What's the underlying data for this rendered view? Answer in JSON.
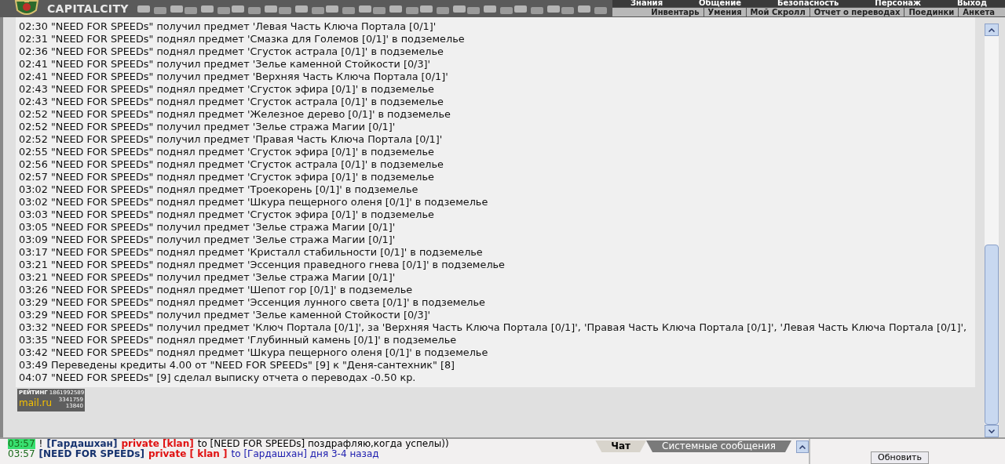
{
  "header": {
    "logo": "CAPITALCITY",
    "menu": [
      {
        "label": "Знания"
      },
      {
        "label": "Общение"
      },
      {
        "label": "Безопасность"
      },
      {
        "label": "Персонаж"
      },
      {
        "label": "Выход"
      }
    ],
    "submenu": [
      {
        "label": "Инвентарь"
      },
      {
        "label": "Умения"
      },
      {
        "label": "Мой Скролл"
      },
      {
        "label": "Отчет о переводах"
      },
      {
        "label": "Поединки"
      },
      {
        "label": "Анкета"
      }
    ]
  },
  "log": [
    {
      "time": "02:30",
      "text": "\"NEED FOR SPEEDs\" получил предмет 'Левая Часть Ключа Портала [0/1]'"
    },
    {
      "time": "02:31",
      "text": "\"NEED FOR SPEEDs\" поднял предмет 'Смазка для Големов [0/1]' в подземелье"
    },
    {
      "time": "02:36",
      "text": "\"NEED FOR SPEEDs\" поднял предмет 'Сгусток астрала [0/1]' в подземелье"
    },
    {
      "time": "02:41",
      "text": "\"NEED FOR SPEEDs\" получил предмет 'Зелье каменной Стойкости [0/3]'"
    },
    {
      "time": "02:41",
      "text": "\"NEED FOR SPEEDs\" получил предмет 'Верхняя Часть Ключа Портала [0/1]'"
    },
    {
      "time": "02:43",
      "text": "\"NEED FOR SPEEDs\" поднял предмет 'Сгусток эфира [0/1]' в подземелье"
    },
    {
      "time": "02:43",
      "text": "\"NEED FOR SPEEDs\" поднял предмет 'Сгусток астрала [0/1]' в подземелье"
    },
    {
      "time": "02:52",
      "text": "\"NEED FOR SPEEDs\" поднял предмет 'Железное дерево [0/1]' в подземелье"
    },
    {
      "time": "02:52",
      "text": "\"NEED FOR SPEEDs\" получил предмет 'Зелье стража Магии [0/1]'"
    },
    {
      "time": "02:52",
      "text": "\"NEED FOR SPEEDs\" получил предмет 'Правая Часть Ключа Портала [0/1]'"
    },
    {
      "time": "02:55",
      "text": "\"NEED FOR SPEEDs\" поднял предмет 'Сгусток эфира [0/1]' в подземелье"
    },
    {
      "time": "02:56",
      "text": "\"NEED FOR SPEEDs\" поднял предмет 'Сгусток астрала [0/1]' в подземелье"
    },
    {
      "time": "02:57",
      "text": "\"NEED FOR SPEEDs\" поднял предмет 'Сгусток эфира [0/1]' в подземелье"
    },
    {
      "time": "03:02",
      "text": "\"NEED FOR SPEEDs\" поднял предмет 'Троекорень [0/1]' в подземелье"
    },
    {
      "time": "03:02",
      "text": "\"NEED FOR SPEEDs\" поднял предмет 'Шкура пещерного оленя [0/1]' в подземелье"
    },
    {
      "time": "03:03",
      "text": "\"NEED FOR SPEEDs\" поднял предмет 'Сгусток эфира [0/1]' в подземелье"
    },
    {
      "time": "03:05",
      "text": "\"NEED FOR SPEEDs\" получил предмет 'Зелье стража Магии [0/1]'"
    },
    {
      "time": "03:09",
      "text": "\"NEED FOR SPEEDs\" получил предмет 'Зелье стража Магии [0/1]'"
    },
    {
      "time": "03:17",
      "text": "\"NEED FOR SPEEDs\" поднял предмет 'Кристалл стабильности [0/1]' в подземелье"
    },
    {
      "time": "03:21",
      "text": "\"NEED FOR SPEEDs\" поднял предмет 'Эссенция праведного гнева [0/1]' в подземелье"
    },
    {
      "time": "03:21",
      "text": "\"NEED FOR SPEEDs\" получил предмет 'Зелье стража Магии [0/1]'"
    },
    {
      "time": "03:26",
      "text": "\"NEED FOR SPEEDs\" поднял предмет 'Шепот гор [0/1]' в подземелье"
    },
    {
      "time": "03:29",
      "text": "\"NEED FOR SPEEDs\" поднял предмет 'Эссенция лунного света [0/1]' в подземелье"
    },
    {
      "time": "03:29",
      "text": "\"NEED FOR SPEEDs\" получил предмет 'Зелье каменной Стойкости [0/3]'"
    },
    {
      "time": "03:32",
      "text": "\"NEED FOR SPEEDs\" получил предмет 'Ключ Портала [0/1]', за 'Верхняя Часть Ключа Портала [0/1]', 'Правая Часть Ключа Портала [0/1]', 'Левая Часть Ключа Портала [0/1]',"
    },
    {
      "time": "03:35",
      "text": "\"NEED FOR SPEEDs\" поднял предмет 'Глубинный камень [0/1]' в подземелье"
    },
    {
      "time": "03:42",
      "text": "\"NEED FOR SPEEDs\" поднял предмет 'Шкура пещерного оленя [0/1]' в подземелье"
    },
    {
      "time": "03:49",
      "text": "Переведены кредиты 4.00 от \"NEED FOR SPEEDs\" [9] к \"Деня-сантехник\" [8]"
    },
    {
      "time": "04:07",
      "text": "\"NEED FOR SPEEDs\" [9] сделал выписку отчета о переводах -0.50 кр."
    }
  ],
  "counter": {
    "title": "РЕЙТИНГ",
    "hits": "1861992589",
    "logo": "mail.ru",
    "visitors": "3341759",
    "today": "13840"
  },
  "chat": [
    {
      "highlighted": true,
      "parts": [
        {
          "kind": "time",
          "text": "03:57"
        },
        {
          "kind": "plain",
          "text": "!"
        },
        {
          "kind": "name",
          "text": "[Гардашхан]"
        },
        {
          "kind": "private",
          "text": "private [klan]"
        },
        {
          "kind": "plain",
          "text": "to [NEED FOR SPEEDs] поздрафляю,когда успелы))"
        }
      ]
    },
    {
      "highlighted": false,
      "parts": [
        {
          "kind": "time",
          "text": "03:57"
        },
        {
          "kind": "name",
          "text": "[NEED FOR SPEEDs]"
        },
        {
          "kind": "private",
          "text": "private [ klan ]"
        },
        {
          "kind": "blue",
          "text": "to [Гардашхан] дня 3-4 назад"
        }
      ]
    }
  ],
  "tabs": [
    {
      "label": "Чат",
      "selected": true
    },
    {
      "label": "Системные сообщения",
      "selected": false
    }
  ],
  "refresh_button": "Обновить"
}
